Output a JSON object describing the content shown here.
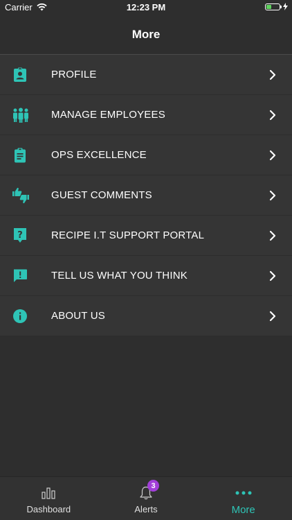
{
  "status_bar": {
    "carrier": "Carrier",
    "time": "12:23 PM"
  },
  "nav": {
    "title": "More"
  },
  "accent_color": "#2ec4b6",
  "menu": {
    "items": [
      {
        "label": "PROFILE",
        "icon": "profile-badge-icon"
      },
      {
        "label": "MANAGE EMPLOYEES",
        "icon": "group-icon"
      },
      {
        "label": "OPS EXCELLENCE",
        "icon": "clipboard-icon"
      },
      {
        "label": "GUEST COMMENTS",
        "icon": "thumbs-up-down-icon"
      },
      {
        "label": "RECIPE I.T SUPPORT PORTAL",
        "icon": "help-speech-icon"
      },
      {
        "label": "TELL US WHAT YOU THINK",
        "icon": "feedback-icon"
      },
      {
        "label": "ABOUT US",
        "icon": "info-icon"
      }
    ]
  },
  "tabs": {
    "dashboard": "Dashboard",
    "alerts": "Alerts",
    "alerts_badge": "3",
    "more": "More"
  }
}
